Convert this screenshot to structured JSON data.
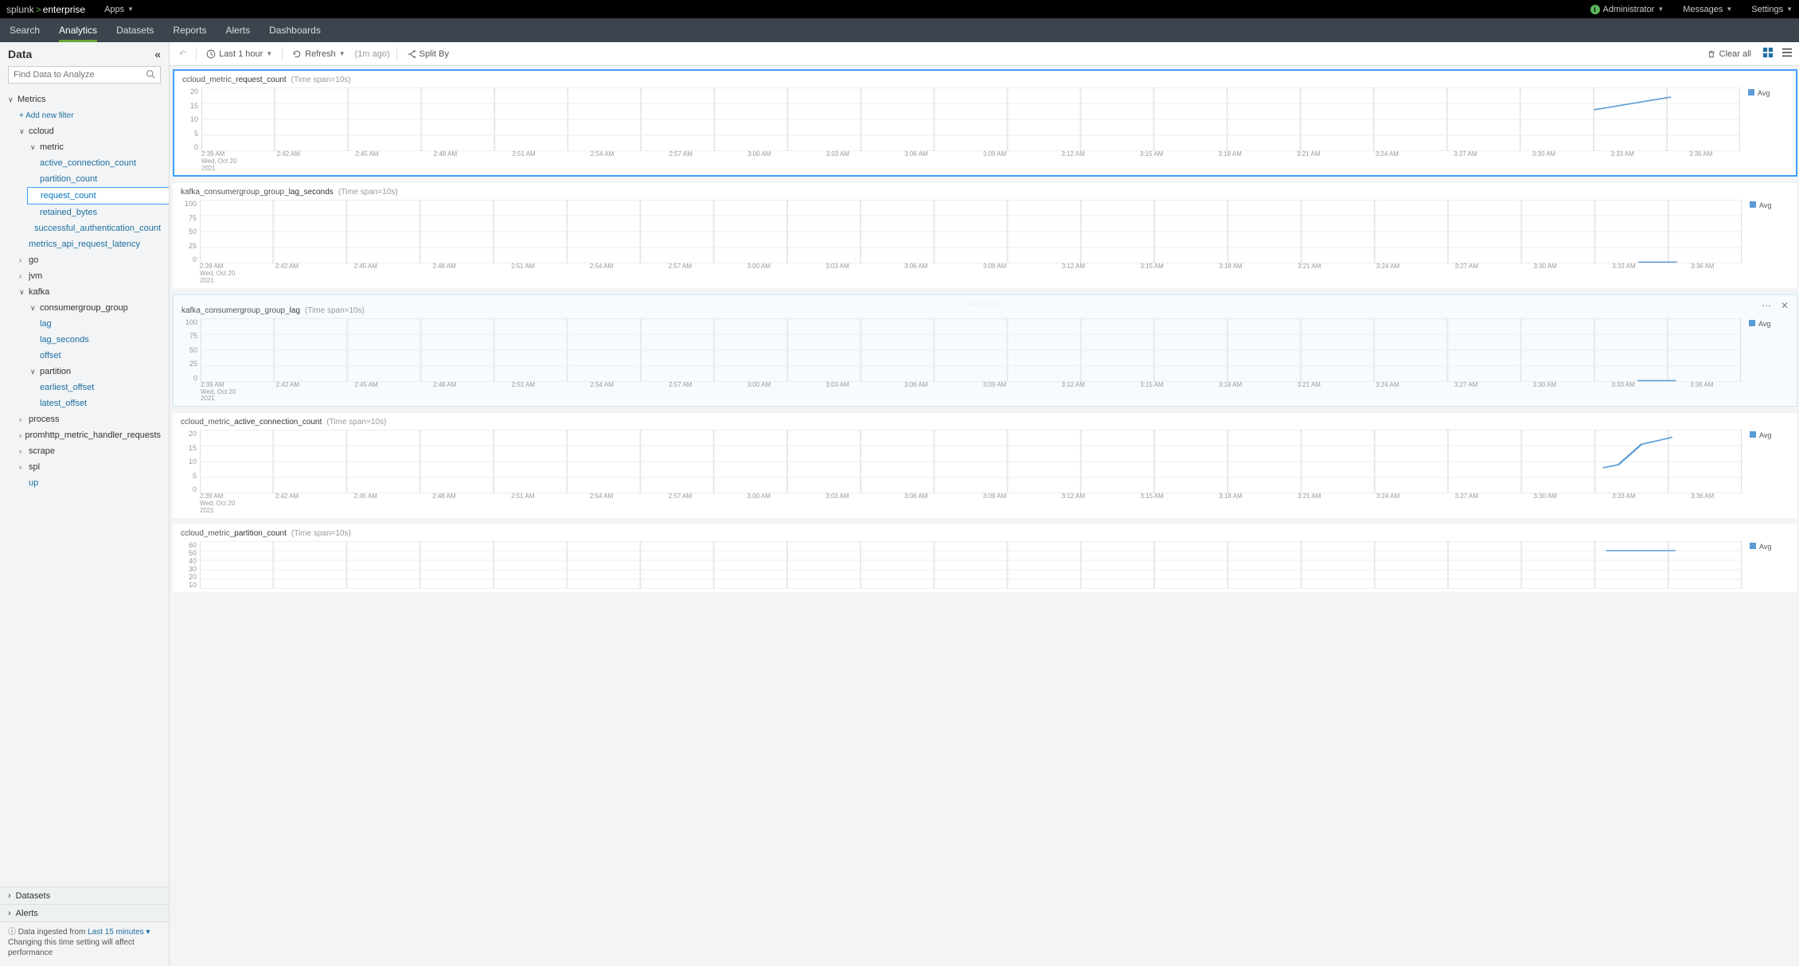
{
  "header": {
    "brand_left": "splunk",
    "brand_right": "enterprise",
    "apps_label": "Apps",
    "admin": "Administrator",
    "messages": "Messages",
    "settings": "Settings"
  },
  "nav": {
    "items": [
      "Search",
      "Analytics",
      "Datasets",
      "Reports",
      "Alerts",
      "Dashboards"
    ],
    "active_index": 1
  },
  "sidebar": {
    "title": "Data",
    "search_placeholder": "Find Data to Analyze",
    "metrics_label": "Metrics",
    "add_filter": "+ Add new filter",
    "ccloud": "ccloud",
    "metric": "metric",
    "metric_children": [
      "active_connection_count",
      "partition_count",
      "request_count",
      "retained_bytes",
      "successful_authentication_count"
    ],
    "metric_active_index": 2,
    "metrics_api": "metrics_api_request_latency",
    "go": "go",
    "jvm": "jvm",
    "kafka": "kafka",
    "consumergroup": "consumergroup_group",
    "cg_children": [
      "lag",
      "lag_seconds",
      "offset"
    ],
    "partition": "partition",
    "partition_children": [
      "earliest_offset",
      "latest_offset"
    ],
    "process": "process",
    "promhttp": "promhttp_metric_handler_requests",
    "scrape": "scrape",
    "spl": "spl",
    "up": "up",
    "datasets": "Datasets",
    "alerts": "Alerts",
    "ingest_prefix": "Data ingested from ",
    "ingest_link": "Last 15 minutes ▾",
    "ingest_note": "Changing this time setting will affect performance"
  },
  "toolbar": {
    "time": "Last 1 hour",
    "refresh": "Refresh",
    "ago": "(1m ago)",
    "splitby": "Split By",
    "clear": "Clear all"
  },
  "charts": [
    {
      "prefix": "ccloud_metric_",
      "bold": "request_count",
      "span": "(Time span=10s)",
      "yticks": [
        "20",
        "15",
        "10",
        "5",
        "0"
      ],
      "legend": "Avg",
      "selected": true,
      "line_path": "M 0.905,0.35 L 0.955,0.15"
    },
    {
      "prefix": "kafka_consumergroup_group_",
      "bold": "lag_seconds",
      "span": "(Time span=10s)",
      "yticks": [
        "100",
        "75",
        "50",
        "25",
        "0"
      ],
      "legend": "Avg",
      "line_path": "M 0.933,0.98 L 0.958,0.98"
    },
    {
      "prefix": "kafka_consumergroup_group_",
      "bold": "lag",
      "span": "(Time span=10s)",
      "yticks": [
        "100",
        "75",
        "50",
        "25",
        "0"
      ],
      "legend": "Avg",
      "hover": true,
      "actions": true,
      "line_path": "M 0.933,0.98 L 0.958,0.98"
    },
    {
      "prefix": "ccloud_metric_",
      "bold": "active_connection_count",
      "span": "(Time span=10s)",
      "yticks": [
        "20",
        "15",
        "10",
        "5",
        "0"
      ],
      "legend": "Avg",
      "line_path": "M 0.91,0.6 L 0.92,0.55 L 0.935,0.23 L 0.955,0.12"
    },
    {
      "prefix": "ccloud_metric_",
      "bold": "partition_count",
      "span": "(Time span=10s)",
      "yticks": [
        "60",
        "50",
        "40",
        "30",
        "20",
        "10"
      ],
      "legend": "Avg",
      "partial": true,
      "line_path": "M 0.912,0.2 L 0.957,0.2"
    }
  ],
  "xaxis": {
    "first": "2:39 AM\nWed, Oct 20\n2021",
    "ticks": [
      "2:42 AM",
      "2:45 AM",
      "2:48 AM",
      "2:51 AM",
      "2:54 AM",
      "2:57 AM",
      "3:00 AM",
      "3:03 AM",
      "3:06 AM",
      "3:09 AM",
      "3:12 AM",
      "3:15 AM",
      "3:18 AM",
      "3:21 AM",
      "3:24 AM",
      "3:27 AM",
      "3:30 AM",
      "3:33 AM",
      "3:36 AM"
    ]
  },
  "chart_data": [
    {
      "type": "line",
      "title": "ccloud_metric_request_count (Time span=10s)",
      "ylim": [
        0,
        20
      ],
      "x": [
        "3:32 AM",
        "3:35 AM"
      ],
      "y": [
        13,
        17
      ],
      "series_name": "Avg"
    },
    {
      "type": "line",
      "title": "kafka_consumergroup_group_lag_seconds (Time span=10s)",
      "ylim": [
        0,
        100
      ],
      "x": [
        "3:33 AM",
        "3:35 AM"
      ],
      "y": [
        2,
        2
      ],
      "series_name": "Avg"
    },
    {
      "type": "line",
      "title": "kafka_consumergroup_group_lag (Time span=10s)",
      "ylim": [
        0,
        100
      ],
      "x": [
        "3:33 AM",
        "3:35 AM"
      ],
      "y": [
        2,
        2
      ],
      "series_name": "Avg"
    },
    {
      "type": "line",
      "title": "ccloud_metric_active_connection_count (Time span=10s)",
      "ylim": [
        0,
        20
      ],
      "x": [
        "3:32 AM",
        "3:33 AM",
        "3:34 AM",
        "3:35 AM"
      ],
      "y": [
        8,
        9,
        15,
        17
      ],
      "series_name": "Avg"
    },
    {
      "type": "line",
      "title": "ccloud_metric_partition_count (Time span=10s)",
      "ylim": [
        10,
        60
      ],
      "x": [
        "3:32 AM",
        "3:35 AM"
      ],
      "y": [
        50,
        50
      ],
      "series_name": "Avg"
    }
  ]
}
